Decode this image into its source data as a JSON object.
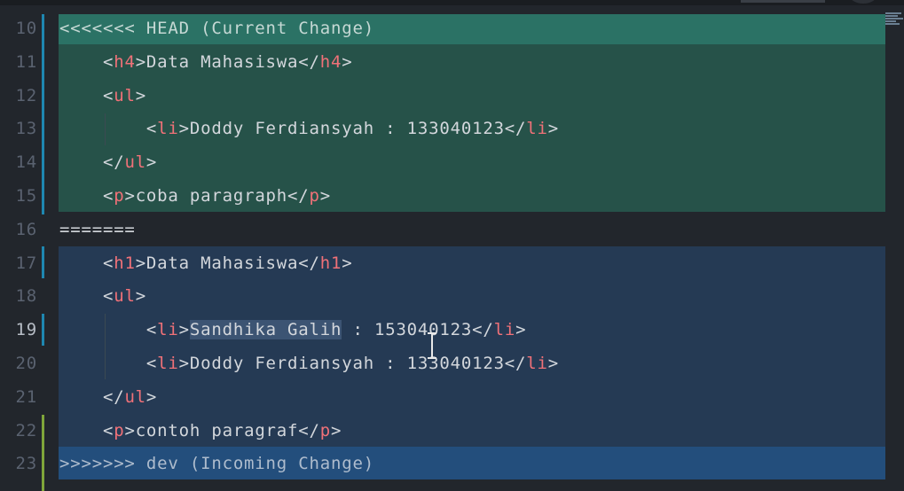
{
  "editor": {
    "lines": [
      {
        "num": "10",
        "kind": "marker-head",
        "parts": [
          {
            "t": "<<<<<<< HEAD (Current Change)",
            "c": "marker-text"
          }
        ]
      },
      {
        "num": "11",
        "kind": "current",
        "parts": [
          {
            "t": "    <",
            "c": "punct"
          },
          {
            "t": "h4",
            "c": "tag"
          },
          {
            "t": ">Data Mahasiswa</",
            "c": "punct"
          },
          {
            "t": "h4",
            "c": "tag"
          },
          {
            "t": ">",
            "c": "punct"
          }
        ]
      },
      {
        "num": "12",
        "kind": "current",
        "parts": [
          {
            "t": "    <",
            "c": "punct"
          },
          {
            "t": "ul",
            "c": "tag"
          },
          {
            "t": ">",
            "c": "punct"
          }
        ]
      },
      {
        "num": "13",
        "kind": "current",
        "parts": [
          {
            "t": "        <",
            "c": "punct"
          },
          {
            "t": "li",
            "c": "tag"
          },
          {
            "t": ">Doddy Ferdiansyah : 133040123</",
            "c": "punct"
          },
          {
            "t": "li",
            "c": "tag"
          },
          {
            "t": ">",
            "c": "punct"
          }
        ]
      },
      {
        "num": "14",
        "kind": "current",
        "parts": [
          {
            "t": "    </",
            "c": "punct"
          },
          {
            "t": "ul",
            "c": "tag"
          },
          {
            "t": ">",
            "c": "punct"
          }
        ]
      },
      {
        "num": "15",
        "kind": "current",
        "parts": [
          {
            "t": "    <",
            "c": "punct"
          },
          {
            "t": "p",
            "c": "tag"
          },
          {
            "t": ">coba paragraph</",
            "c": "punct"
          },
          {
            "t": "p",
            "c": "tag"
          },
          {
            "t": ">",
            "c": "punct"
          }
        ]
      },
      {
        "num": "16",
        "kind": "separator",
        "parts": [
          {
            "t": "=======",
            "c": "punct"
          }
        ]
      },
      {
        "num": "17",
        "kind": "incoming",
        "parts": [
          {
            "t": "    <",
            "c": "punct"
          },
          {
            "t": "h1",
            "c": "tag"
          },
          {
            "t": ">Data Mahasiswa</",
            "c": "punct"
          },
          {
            "t": "h1",
            "c": "tag"
          },
          {
            "t": ">",
            "c": "punct"
          }
        ]
      },
      {
        "num": "18",
        "kind": "incoming",
        "parts": [
          {
            "t": "    <",
            "c": "punct"
          },
          {
            "t": "ul",
            "c": "tag"
          },
          {
            "t": ">",
            "c": "punct"
          }
        ]
      },
      {
        "num": "19",
        "kind": "incoming",
        "active": true,
        "parts": [
          {
            "t": "        <",
            "c": "punct"
          },
          {
            "t": "li",
            "c": "tag"
          },
          {
            "t": ">",
            "c": "punct"
          },
          {
            "t": "Sandhika Galih",
            "c": "punct sel"
          },
          {
            "t": " : 153040123</",
            "c": "punct"
          },
          {
            "t": "li",
            "c": "tag"
          },
          {
            "t": ">",
            "c": "punct"
          }
        ]
      },
      {
        "num": "20",
        "kind": "incoming",
        "parts": [
          {
            "t": "        <",
            "c": "punct"
          },
          {
            "t": "li",
            "c": "tag"
          },
          {
            "t": ">Doddy Ferdiansyah : 133040123</",
            "c": "punct"
          },
          {
            "t": "li",
            "c": "tag"
          },
          {
            "t": ">",
            "c": "punct"
          }
        ]
      },
      {
        "num": "21",
        "kind": "incoming",
        "parts": [
          {
            "t": "    </",
            "c": "punct"
          },
          {
            "t": "ul",
            "c": "tag"
          },
          {
            "t": ">",
            "c": "punct"
          }
        ]
      },
      {
        "num": "22",
        "kind": "incoming",
        "parts": [
          {
            "t": "    <",
            "c": "punct"
          },
          {
            "t": "p",
            "c": "tag"
          },
          {
            "t": ">contoh paragraf</",
            "c": "punct"
          },
          {
            "t": "p",
            "c": "tag"
          },
          {
            "t": ">",
            "c": "punct"
          }
        ]
      },
      {
        "num": "23",
        "kind": "marker-incoming",
        "parts": [
          {
            "t": ">>>>>>> dev (Incoming Change)",
            "c": "inc-text"
          }
        ]
      }
    ]
  },
  "colors": {
    "tag": "#f07178",
    "current_header": "#2b7265",
    "current_body": "#265249",
    "incoming_body": "#253a54",
    "incoming_header": "#234e7c"
  }
}
